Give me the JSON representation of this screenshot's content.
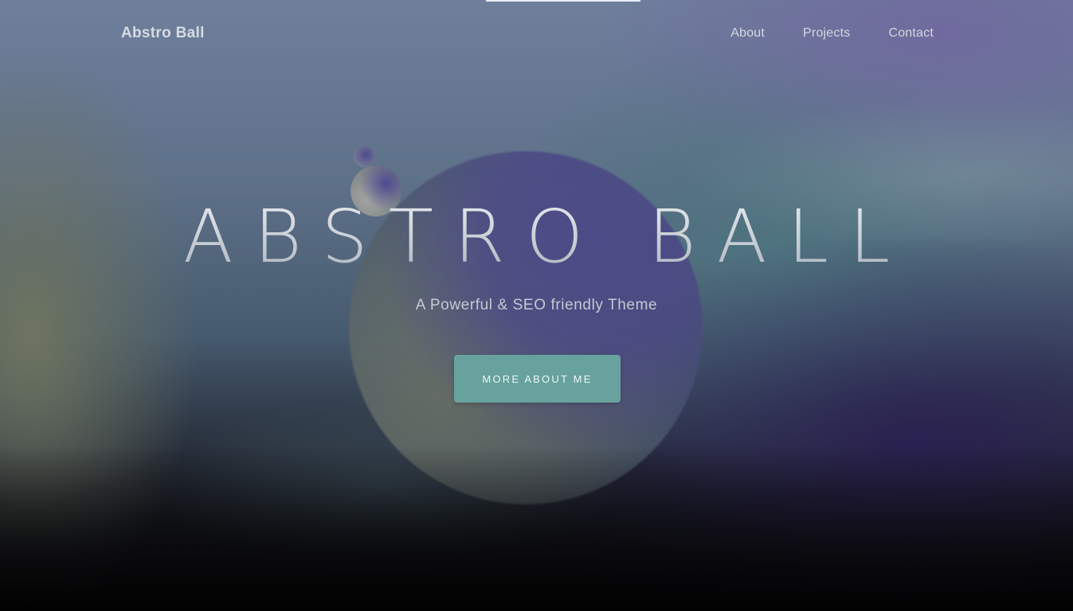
{
  "navbar": {
    "brand": "Abstro Ball",
    "links": [
      {
        "label": "About"
      },
      {
        "label": "Projects"
      },
      {
        "label": "Contact"
      }
    ]
  },
  "hero": {
    "title": "ABSTRO BALL",
    "subtitle": "A Powerful & SEO friendly Theme",
    "cta_label": "MORE ABOUT ME"
  },
  "colors": {
    "accent": "#67a29e",
    "text_light": "#d6dbe1"
  }
}
